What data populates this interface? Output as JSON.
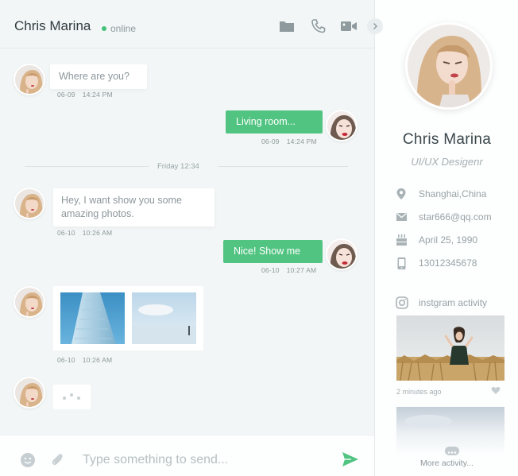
{
  "header": {
    "contact_name": "Chris Marina",
    "status": "online",
    "icons": [
      "folder-icon",
      "phone-icon",
      "video-camera-icon"
    ],
    "status_color": "#43c07a"
  },
  "messages": [
    {
      "side": "in",
      "text": "Where are you?",
      "date": "06-09",
      "time": "14:24 PM"
    },
    {
      "side": "out",
      "text": "Living room...",
      "date": "06-09",
      "time": "14:24 PM"
    },
    {
      "side": "in",
      "text": "Hey,  I want show you some amazing photos.",
      "date": "06-10",
      "time": "10:26 AM"
    },
    {
      "side": "out",
      "text": "Nice! Show me",
      "date": "06-10",
      "time": "10:27 AM"
    },
    {
      "side": "in",
      "type": "photos",
      "date": "06-10",
      "time": "10:26 AM"
    },
    {
      "side": "in",
      "type": "typing"
    }
  ],
  "day_divider": "Friday 12:34",
  "composer": {
    "placeholder": "Type something to send...",
    "icons": [
      "emoji-icon",
      "paperclip-icon",
      "send-icon"
    ]
  },
  "profile": {
    "name": "Chris Marina",
    "role": "UI/UX Desigenr",
    "location": "Shanghai,China",
    "email": "star666@qq.com",
    "birthday": "April 25,  1990",
    "phone": "13012345678",
    "instagram_label": "instgram activity",
    "instagram_time": "2 minutes ago",
    "more_label": "More activity..."
  },
  "colors": {
    "accent": "#52c482",
    "background": "#f2f6f6",
    "panel": "#fdfefe"
  }
}
